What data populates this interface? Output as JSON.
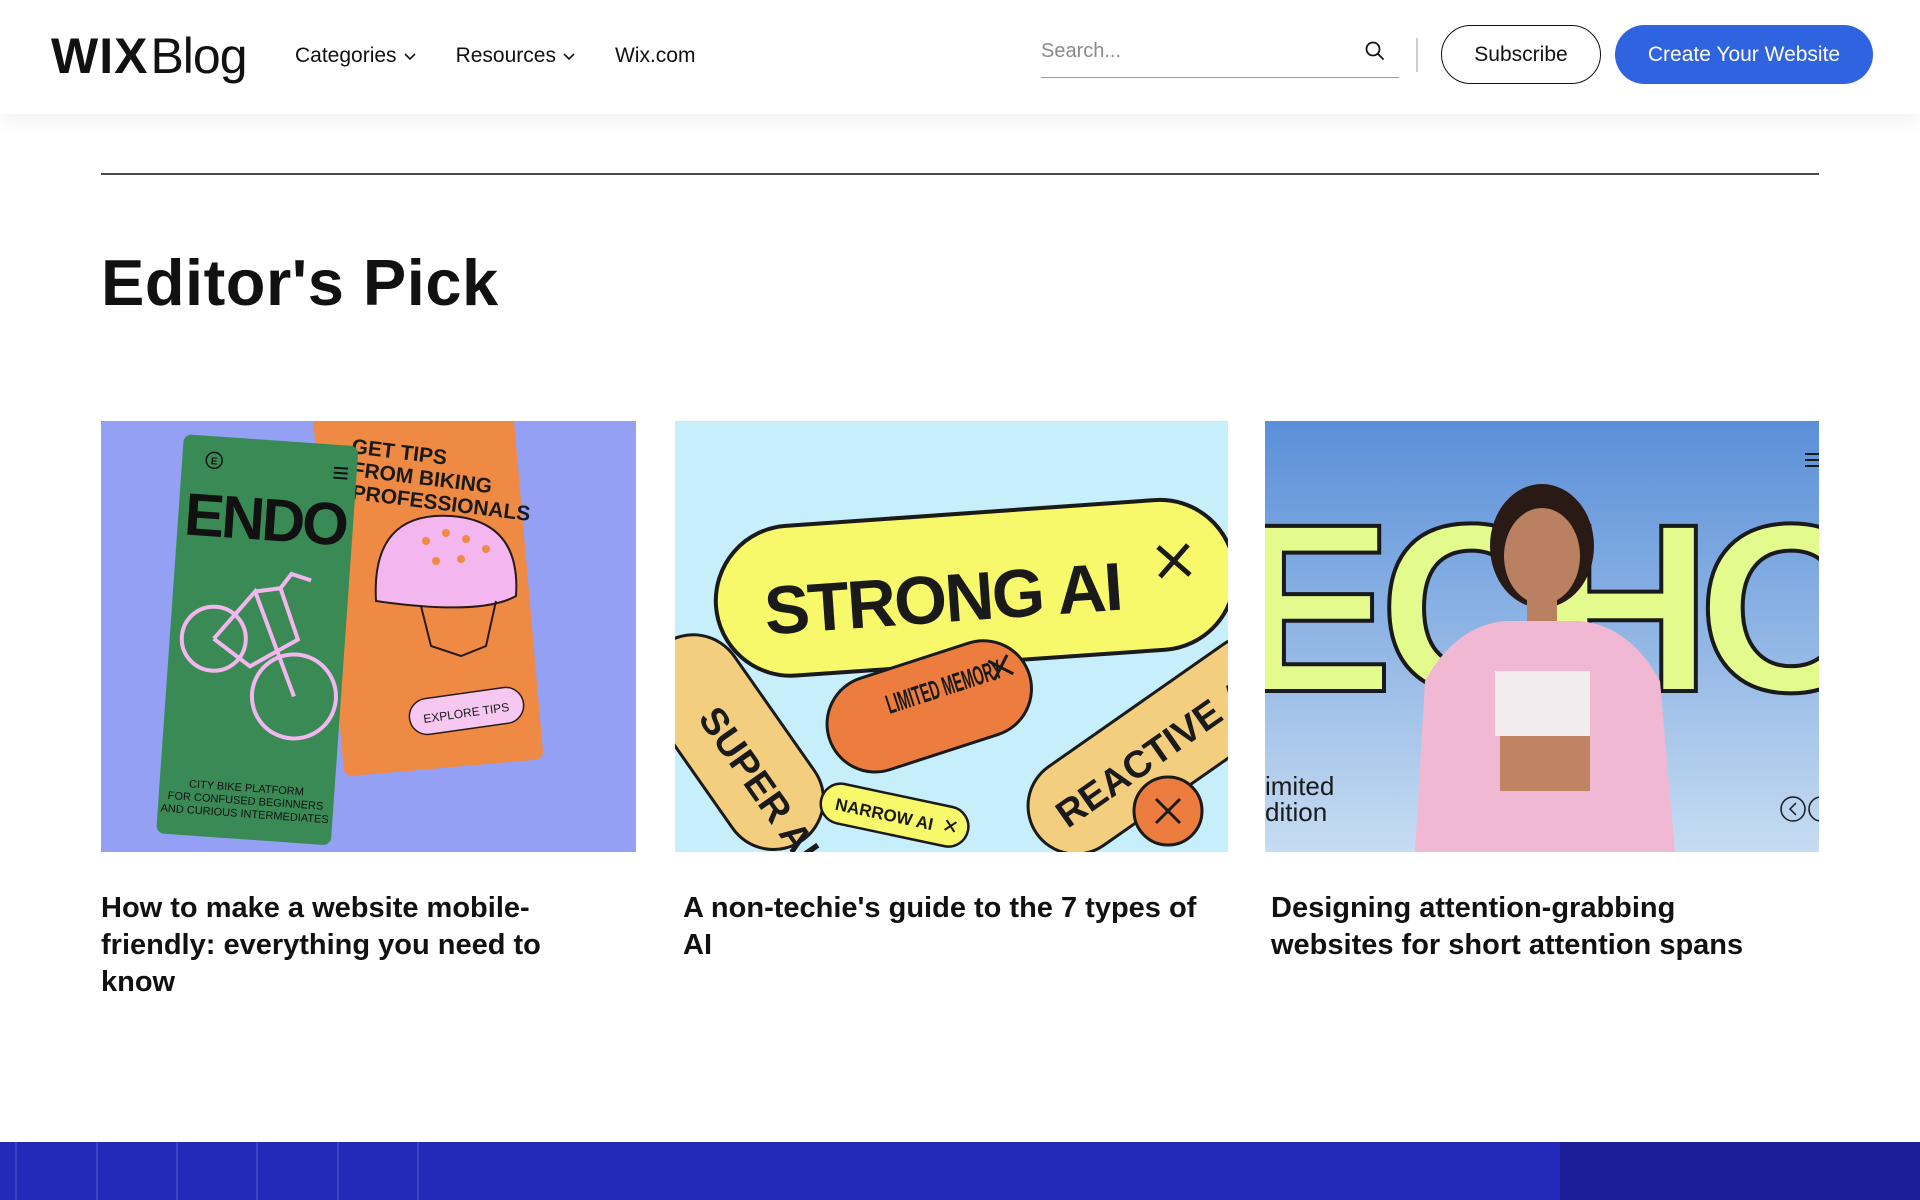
{
  "header": {
    "logo_wix": "WIX",
    "logo_blog": "Blog",
    "nav": [
      {
        "label": "Categories",
        "has_dropdown": true
      },
      {
        "label": "Resources",
        "has_dropdown": true
      },
      {
        "label": "Wix.com",
        "has_dropdown": false
      }
    ],
    "search_placeholder": "Search...",
    "subscribe_label": "Subscribe",
    "create_label": "Create Your Website"
  },
  "section": {
    "title": "Editor's Pick"
  },
  "cards": [
    {
      "title": "How to make a website mobile-friendly: everything you need to know",
      "image": {
        "headline": "ENDO",
        "promo_line1": "GET TIPS",
        "promo_line2": "FROM BIKING",
        "promo_line3": "PROFESSIONALS",
        "button": "EXPLORE TIPS",
        "tagline1": "CITY BIKE PLATFORM",
        "tagline2": "FOR CONFUSED BEGINNERS",
        "tagline3": "AND CURIOUS INTERMEDIATES",
        "badge": "E"
      }
    },
    {
      "title": "A non-techie's guide to the 7 types of AI",
      "image": {
        "pill_main": "STRONG AI",
        "pill_left": "SUPER AI",
        "pill_mid": "LIMITED MEMORY",
        "pill_right": "REACTIVE AI",
        "pill_small": "NARROW AI"
      }
    },
    {
      "title": "Designing attention-grabbing websites for short attention spans",
      "image": {
        "headline": "ECHO",
        "side_text1": "imited",
        "side_text2": "dition"
      }
    }
  ],
  "colors": {
    "accent": "#2f63e0",
    "footer_band": "#2329b8"
  }
}
